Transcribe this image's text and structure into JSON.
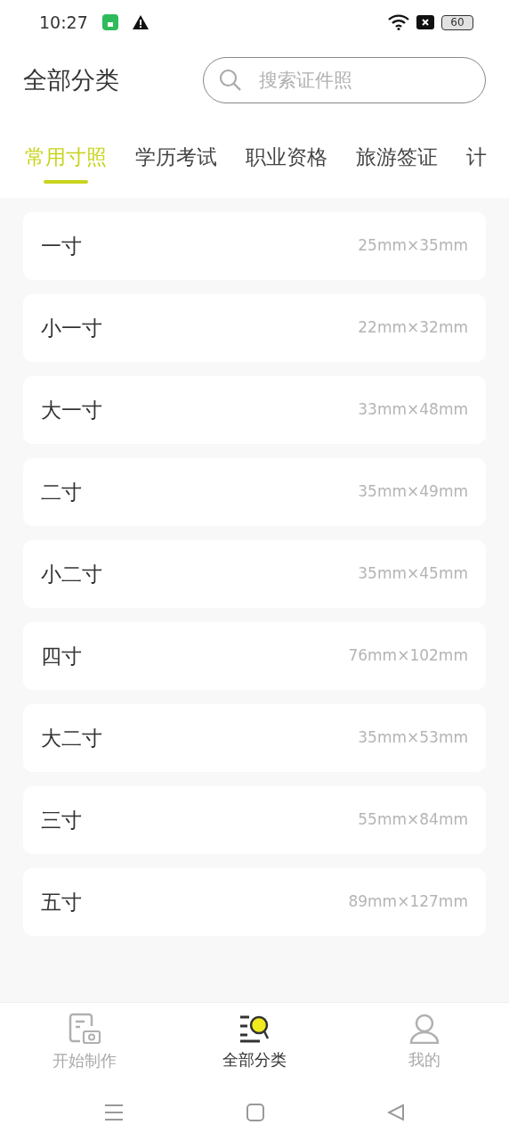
{
  "status_bar": {
    "time": "10:27",
    "battery": "60"
  },
  "header": {
    "title": "全部分类",
    "search": {
      "placeholder": "搜索证件照"
    }
  },
  "tabs": [
    {
      "label": "常用寸照",
      "selected": true
    },
    {
      "label": "学历考试",
      "selected": false
    },
    {
      "label": "职业资格",
      "selected": false
    },
    {
      "label": "旅游签证",
      "selected": false
    },
    {
      "label": "计",
      "selected": false
    }
  ],
  "sizes": [
    {
      "name": "一寸",
      "dimensions": "25mm×35mm"
    },
    {
      "name": "小一寸",
      "dimensions": "22mm×32mm"
    },
    {
      "name": "大一寸",
      "dimensions": "33mm×48mm"
    },
    {
      "name": "二寸",
      "dimensions": "35mm×49mm"
    },
    {
      "name": "小二寸",
      "dimensions": "35mm×45mm"
    },
    {
      "name": "四寸",
      "dimensions": "76mm×102mm"
    },
    {
      "name": "大二寸",
      "dimensions": "35mm×53mm"
    },
    {
      "name": "三寸",
      "dimensions": "55mm×84mm"
    },
    {
      "name": "五寸",
      "dimensions": "89mm×127mm"
    }
  ],
  "bottom_nav": [
    {
      "label": "开始制作",
      "kind": "create",
      "selected": false
    },
    {
      "label": "全部分类",
      "kind": "categories",
      "selected": true
    },
    {
      "label": "我的",
      "kind": "profile",
      "selected": false
    }
  ]
}
